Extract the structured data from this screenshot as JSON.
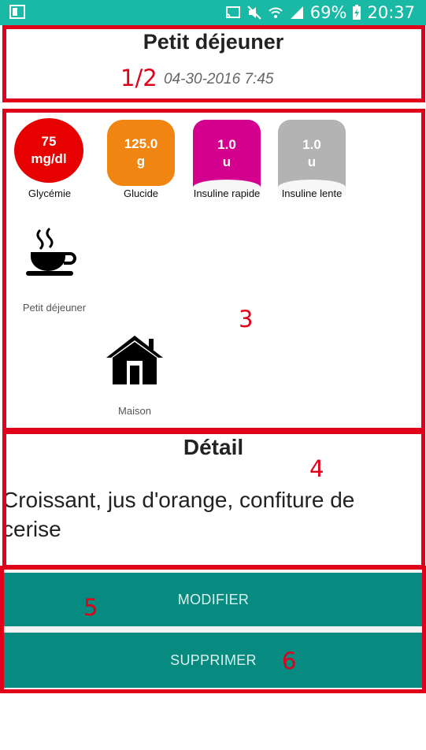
{
  "status_bar": {
    "battery": "69%",
    "time": "20:37",
    "icons": [
      "cast-icon",
      "mute-icon",
      "wifi-icon",
      "signal-icon",
      "battery-icon"
    ]
  },
  "header": {
    "title": "Petit déjeuner",
    "datetime": "04-30-2016 7:45"
  },
  "annotations": {
    "n12": "1/2",
    "n3": "3",
    "n4": "4",
    "n5": "5",
    "n6": "6"
  },
  "measures": [
    {
      "value": "75",
      "unit": "mg/dl",
      "label": "Glycémie",
      "color": "#e60000"
    },
    {
      "value": "125.0",
      "unit": "g",
      "label": "Glucide",
      "color": "#f08512"
    },
    {
      "value": "1.0",
      "unit": "u",
      "label": "Insuline rapide",
      "color": "#d4008e"
    },
    {
      "value": "1.0",
      "unit": "u",
      "label": "Insuline lente",
      "color": "#b3b3b3"
    }
  ],
  "meal": {
    "label": "Petit déjeuner",
    "icon": "coffee-cup-icon"
  },
  "location": {
    "label": "Maison",
    "icon": "house-icon"
  },
  "detail": {
    "title": "Détail",
    "text_line1": "Croissant, jus d'orange, confiture de",
    "text_line2": "cerise"
  },
  "buttons": {
    "modify": "MODIFIER",
    "delete": "SUPPRIMER"
  },
  "colors": {
    "status_bar": "#19b9a6",
    "button": "#078a80",
    "annotation": "#e0001a"
  }
}
